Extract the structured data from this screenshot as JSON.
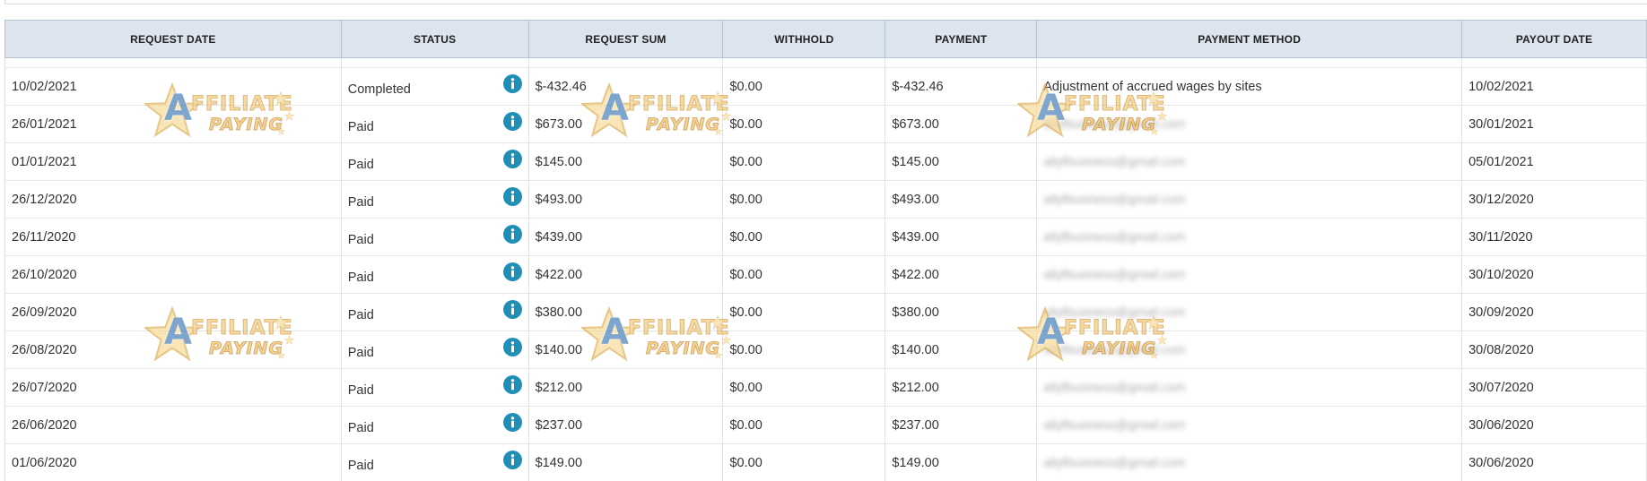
{
  "table": {
    "columns": [
      "REQUEST DATE",
      "STATUS",
      "REQUEST SUM",
      "WITHHOLD",
      "PAYMENT",
      "PAYMENT METHOD",
      "PAYOUT DATE"
    ],
    "rows": [
      {
        "request_date": "10/02/2021",
        "status": "Completed",
        "request_sum": "$-432.46",
        "withhold": "$0.00",
        "payment": "$-432.46",
        "method": "Adjustment of accrued wages by sites",
        "method_blurred": false,
        "payout_date": "10/02/2021"
      },
      {
        "request_date": "26/01/2021",
        "status": "Paid",
        "request_sum": "$673.00",
        "withhold": "$0.00",
        "payment": "$673.00",
        "method": "allyfbusiness@gmail.com",
        "method_blurred": true,
        "payout_date": "30/01/2021"
      },
      {
        "request_date": "01/01/2021",
        "status": "Paid",
        "request_sum": "$145.00",
        "withhold": "$0.00",
        "payment": "$145.00",
        "method": "allyfbusiness@gmail.com",
        "method_blurred": true,
        "payout_date": "05/01/2021"
      },
      {
        "request_date": "26/12/2020",
        "status": "Paid",
        "request_sum": "$493.00",
        "withhold": "$0.00",
        "payment": "$493.00",
        "method": "allyfbusiness@gmail.com",
        "method_blurred": true,
        "payout_date": "30/12/2020"
      },
      {
        "request_date": "26/11/2020",
        "status": "Paid",
        "request_sum": "$439.00",
        "withhold": "$0.00",
        "payment": "$439.00",
        "method": "allyfbusiness@gmail.com",
        "method_blurred": true,
        "payout_date": "30/11/2020"
      },
      {
        "request_date": "26/10/2020",
        "status": "Paid",
        "request_sum": "$422.00",
        "withhold": "$0.00",
        "payment": "$422.00",
        "method": "allyfbusiness@gmail.com",
        "method_blurred": true,
        "payout_date": "30/10/2020"
      },
      {
        "request_date": "26/09/2020",
        "status": "Paid",
        "request_sum": "$380.00",
        "withhold": "$0.00",
        "payment": "$380.00",
        "method": "allyfbusiness@gmail.com",
        "method_blurred": true,
        "payout_date": "30/09/2020"
      },
      {
        "request_date": "26/08/2020",
        "status": "Paid",
        "request_sum": "$140.00",
        "withhold": "$0.00",
        "payment": "$140.00",
        "method": "allyfbusiness@gmail.com",
        "method_blurred": true,
        "payout_date": "30/08/2020"
      },
      {
        "request_date": "26/07/2020",
        "status": "Paid",
        "request_sum": "$212.00",
        "withhold": "$0.00",
        "payment": "$212.00",
        "method": "allyfbusiness@gmail.com",
        "method_blurred": true,
        "payout_date": "30/07/2020"
      },
      {
        "request_date": "26/06/2020",
        "status": "Paid",
        "request_sum": "$237.00",
        "withhold": "$0.00",
        "payment": "$237.00",
        "method": "allyfbusiness@gmail.com",
        "method_blurred": true,
        "payout_date": "30/06/2020"
      },
      {
        "request_date": "01/06/2020",
        "status": "Paid",
        "request_sum": "$149.00",
        "withhold": "$0.00",
        "payment": "$149.00",
        "method": "allyfbusiness@gmail.com",
        "method_blurred": true,
        "payout_date": "30/06/2020"
      }
    ],
    "info_icon": "info-circle-icon"
  },
  "watermark": {
    "letter": "A",
    "line1": "FFILIATE",
    "line2": "PAYING"
  },
  "colors": {
    "header_bg": "#dce5ee",
    "info_icon": "#1f8fb7",
    "watermark_gold": "#f2c46b",
    "watermark_blue": "#2f6fb0"
  }
}
